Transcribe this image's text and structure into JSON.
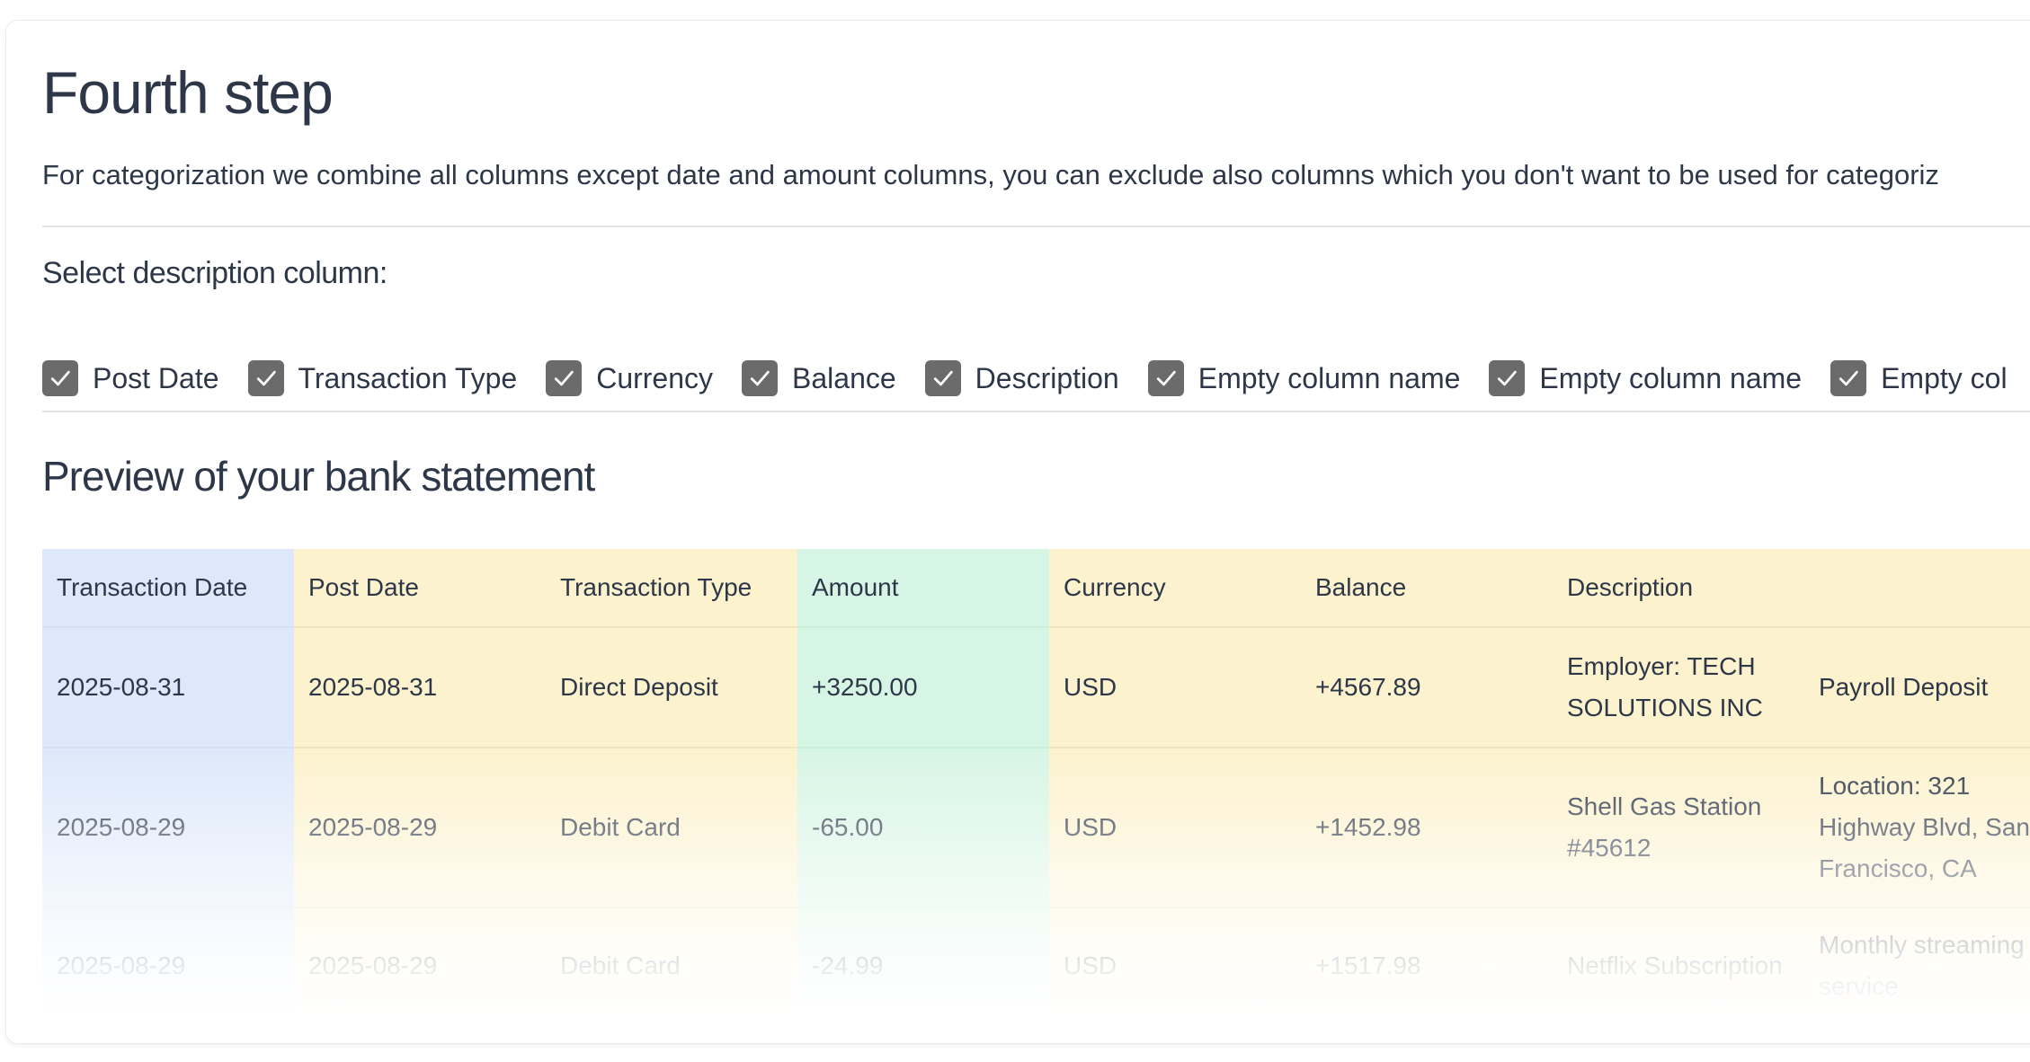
{
  "step": {
    "title": "Fourth step",
    "intro": "For categorization we combine all columns except date and amount columns, you can exclude also columns which you don't want to be used for categoriz"
  },
  "description_select": {
    "heading": "Select description column:",
    "options": [
      {
        "label": "Post Date",
        "checked": true
      },
      {
        "label": "Transaction Type",
        "checked": true
      },
      {
        "label": "Currency",
        "checked": true
      },
      {
        "label": "Balance",
        "checked": true
      },
      {
        "label": "Description",
        "checked": true
      },
      {
        "label": "Empty column name",
        "checked": true
      },
      {
        "label": "Empty column name",
        "checked": true
      },
      {
        "label": "Empty col",
        "checked": true
      }
    ]
  },
  "preview": {
    "title": "Preview of your bank statement",
    "columns": [
      "Transaction Date",
      "Post Date",
      "Transaction Type",
      "Amount",
      "Currency",
      "Balance",
      "Description",
      ""
    ],
    "rows": [
      [
        "2025-08-31",
        "2025-08-31",
        "Direct Deposit",
        "+3250.00",
        "USD",
        "+4567.89",
        "Employer: TECH SOLUTIONS INC",
        "Payroll Deposit"
      ],
      [
        "2025-08-29",
        "2025-08-29",
        "Debit Card",
        "-65.00",
        "USD",
        "+1452.98",
        "Shell Gas Station #45612",
        "Location: 321 Highway Blvd, San Francisco, CA"
      ],
      [
        "2025-08-29",
        "2025-08-29",
        "Debit Card",
        "-24.99",
        "USD",
        "+1517.98",
        "Netflix Subscription",
        "Monthly streaming service"
      ]
    ]
  },
  "colors": {
    "date_column": "#dde8fa",
    "amount_column": "#d7f5e5",
    "other_column": "#fcf2ce",
    "checkbox": "#6b6b6b",
    "text": "#2d3748"
  }
}
